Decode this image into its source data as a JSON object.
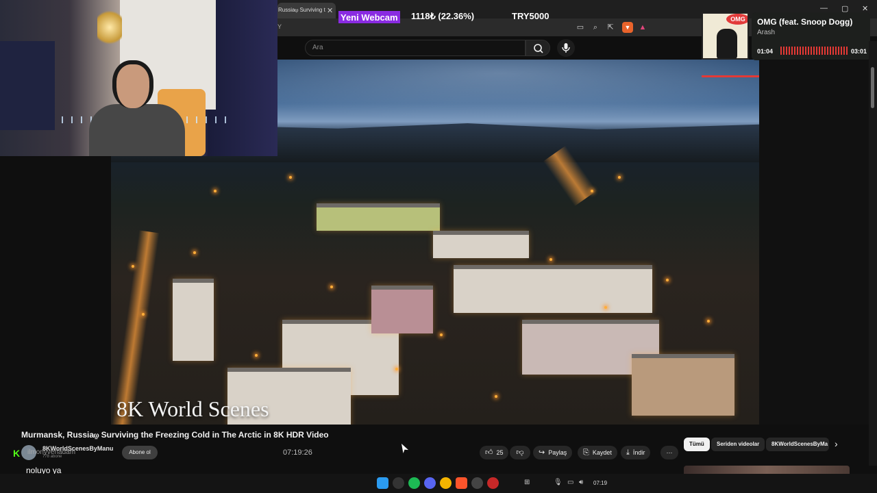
{
  "browser": {
    "tab_title": "Russia⍹ Surviving t",
    "tab_close": "✕",
    "address": "Y",
    "window_controls": [
      "—",
      "▢",
      "✕"
    ]
  },
  "youtube": {
    "search_placeholder": "Ara",
    "video": {
      "watermark": "8K World Scenes",
      "title": "Murmansk, Russia⍹ Surviving the Freezing Cold in The Arctic in 8K HDR Video",
      "channel": "8KWorldScenesByManu",
      "subscribers": "778 abone",
      "subscribe_label": "Abone ol",
      "likes": "25",
      "share_label": "Paylaş",
      "save_label": "Kaydet",
      "download_label": "İndir",
      "more_label": "⋯"
    },
    "chips": [
      {
        "label": "Tümü",
        "active": true
      },
      {
        "label": "Seriden videolar",
        "active": false
      },
      {
        "label": "8KWorldScenesByMa",
        "active": false
      }
    ]
  },
  "stream_overlay": {
    "webcam_label": "Yeni Webcam",
    "goal": "1118₺ (22.36%)",
    "goal_fraction": 0.2236,
    "target": "TRY5000",
    "clock": "07:19:26",
    "chat_username": "ilmonyvenadam",
    "chat_message": "noluyo ya"
  },
  "spotify": {
    "song_title": "OMG (feat. Snoop Dogg)",
    "artist": "Arash",
    "elapsed": "01:04",
    "duration": "03:01",
    "album_badge": "OMG",
    "progress_fraction": 0.35
  },
  "taskbar": {
    "time": "07:19",
    "icons": [
      "windows-icon",
      "obs-icon",
      "spotify-icon",
      "discord-icon",
      "chrome-icon",
      "brave-icon",
      "github-icon",
      "app-icon"
    ]
  },
  "colors": {
    "accent_red": "#e53935",
    "webcam_label_bg": "#8a2be2",
    "kick_green": "#53fc18"
  }
}
